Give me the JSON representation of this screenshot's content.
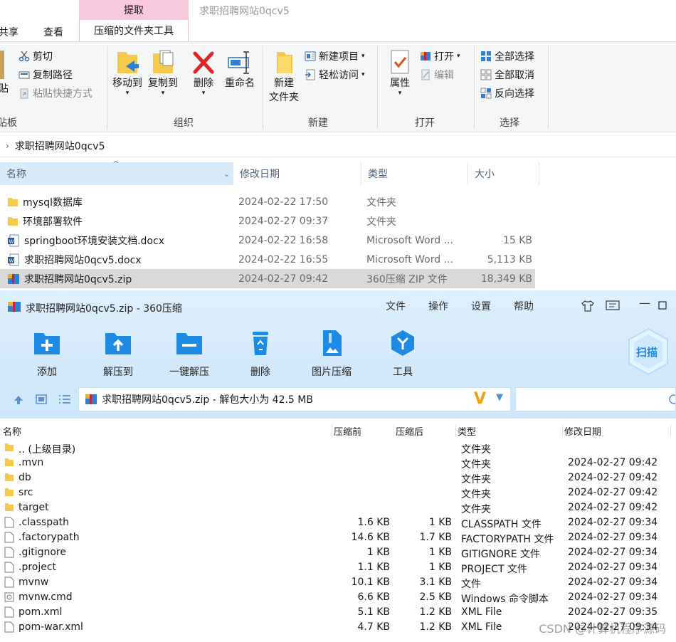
{
  "explorer": {
    "window_title": "求职招聘网站0qcv5",
    "context_tab_top": "提取",
    "context_tab": "压缩的文件夹工具",
    "tabs": [
      "共享",
      "查看"
    ],
    "ribbon": {
      "clipboard": {
        "label": "贴板",
        "paste_partial": "贴",
        "cut": "剪切",
        "copy_path": "复制路径",
        "paste_shortcut": "粘贴快捷方式"
      },
      "organize": {
        "label": "组织",
        "move_to": "移动到",
        "copy_to": "复制到",
        "delete": "删除",
        "rename": "重命名"
      },
      "new": {
        "label": "新建",
        "new_folder_1": "新建",
        "new_folder_2": "文件夹",
        "new_item": "新建项目",
        "easy_access": "轻松访问"
      },
      "open": {
        "label": "打开",
        "properties": "属性",
        "open": "打开",
        "edit": "编辑"
      },
      "select": {
        "label": "选择",
        "select_all": "全部选择",
        "select_none": "全部取消",
        "invert": "反向选择"
      }
    },
    "address": "求职招聘网站0qcv5",
    "columns": {
      "name": "名称",
      "date": "修改日期",
      "type": "类型",
      "size": "大小"
    },
    "files": [
      {
        "name": "mysql数据库",
        "date": "2024-02-22 17:50",
        "type": "文件夹",
        "size": "",
        "icon": "folder-icon"
      },
      {
        "name": "环境部署软件",
        "date": "2024-02-27 09:37",
        "type": "文件夹",
        "size": "",
        "icon": "folder-icon"
      },
      {
        "name": "springboot环境安装文档.docx",
        "date": "2024-02-22 16:58",
        "type": "Microsoft Word ...",
        "size": "15 KB",
        "icon": "docx-icon"
      },
      {
        "name": "求职招聘网站0qcv5.docx",
        "date": "2024-02-22 16:55",
        "type": "Microsoft Word ...",
        "size": "5,113 KB",
        "icon": "docx-icon"
      },
      {
        "name": "求职招聘网站0qcv5.zip",
        "date": "2024-02-27 09:42",
        "type": "360压缩 ZIP 文件",
        "size": "18,349 KB",
        "icon": "zip-icon",
        "selected": true
      }
    ]
  },
  "zip360": {
    "title": "求职招聘网站0qcv5.zip - 360压缩",
    "menu": [
      "文件",
      "操作",
      "设置",
      "帮助"
    ],
    "tools": [
      "添加",
      "解压到",
      "一键解压",
      "删除",
      "图片压缩",
      "工具"
    ],
    "scan_label": "扫描",
    "path": "求职招聘网站0qcv5.zip - 解包大小为 42.5 MB",
    "columns": {
      "name": "名称",
      "pre": "压缩前",
      "post": "压缩后",
      "type": "类型",
      "date": "修改日期"
    },
    "rows": [
      {
        "name": ".. (上级目录)",
        "pre": "",
        "post": "",
        "type": "文件夹",
        "date": "",
        "icon": "folder-icon"
      },
      {
        "name": ".mvn",
        "pre": "",
        "post": "",
        "type": "文件夹",
        "date": "2024-02-27 09:42",
        "icon": "folder-icon"
      },
      {
        "name": "db",
        "pre": "",
        "post": "",
        "type": "文件夹",
        "date": "2024-02-27 09:42",
        "icon": "folder-icon"
      },
      {
        "name": "src",
        "pre": "",
        "post": "",
        "type": "文件夹",
        "date": "2024-02-27 09:42",
        "icon": "folder-icon"
      },
      {
        "name": "target",
        "pre": "",
        "post": "",
        "type": "文件夹",
        "date": "2024-02-27 09:42",
        "icon": "folder-icon"
      },
      {
        "name": ".classpath",
        "pre": "1.6 KB",
        "post": "1 KB",
        "type": "CLASSPATH 文件",
        "date": "2024-02-27 09:34",
        "icon": "file-icon"
      },
      {
        "name": ".factorypath",
        "pre": "14.6 KB",
        "post": "1.7 KB",
        "type": "FACTORYPATH 文件",
        "date": "2024-02-27 09:34",
        "icon": "file-icon"
      },
      {
        "name": ".gitignore",
        "pre": "1 KB",
        "post": "1 KB",
        "type": "GITIGNORE 文件",
        "date": "2024-02-27 09:34",
        "icon": "file-icon"
      },
      {
        "name": ".project",
        "pre": "1.1 KB",
        "post": "1 KB",
        "type": "PROJECT 文件",
        "date": "2024-02-27 09:34",
        "icon": "file-icon"
      },
      {
        "name": "mvnw",
        "pre": "10.1 KB",
        "post": "3.1 KB",
        "type": "文件",
        "date": "2024-02-27 09:34",
        "icon": "file-icon"
      },
      {
        "name": "mvnw.cmd",
        "pre": "6.6 KB",
        "post": "2.5 KB",
        "type": "Windows 命令脚本",
        "date": "2024-02-27 09:34",
        "icon": "cmd-icon"
      },
      {
        "name": "pom.xml",
        "pre": "5.1 KB",
        "post": "1.2 KB",
        "type": "XML File",
        "date": "2024-02-27 09:35",
        "icon": "file-icon"
      },
      {
        "name": "pom-war.xml",
        "pre": "4.7 KB",
        "post": "1.2 KB",
        "type": "XML File",
        "date": "2024-02-27 09:34",
        "icon": "file-icon"
      }
    ]
  },
  "watermark": "CSDN @计算机程序源码"
}
